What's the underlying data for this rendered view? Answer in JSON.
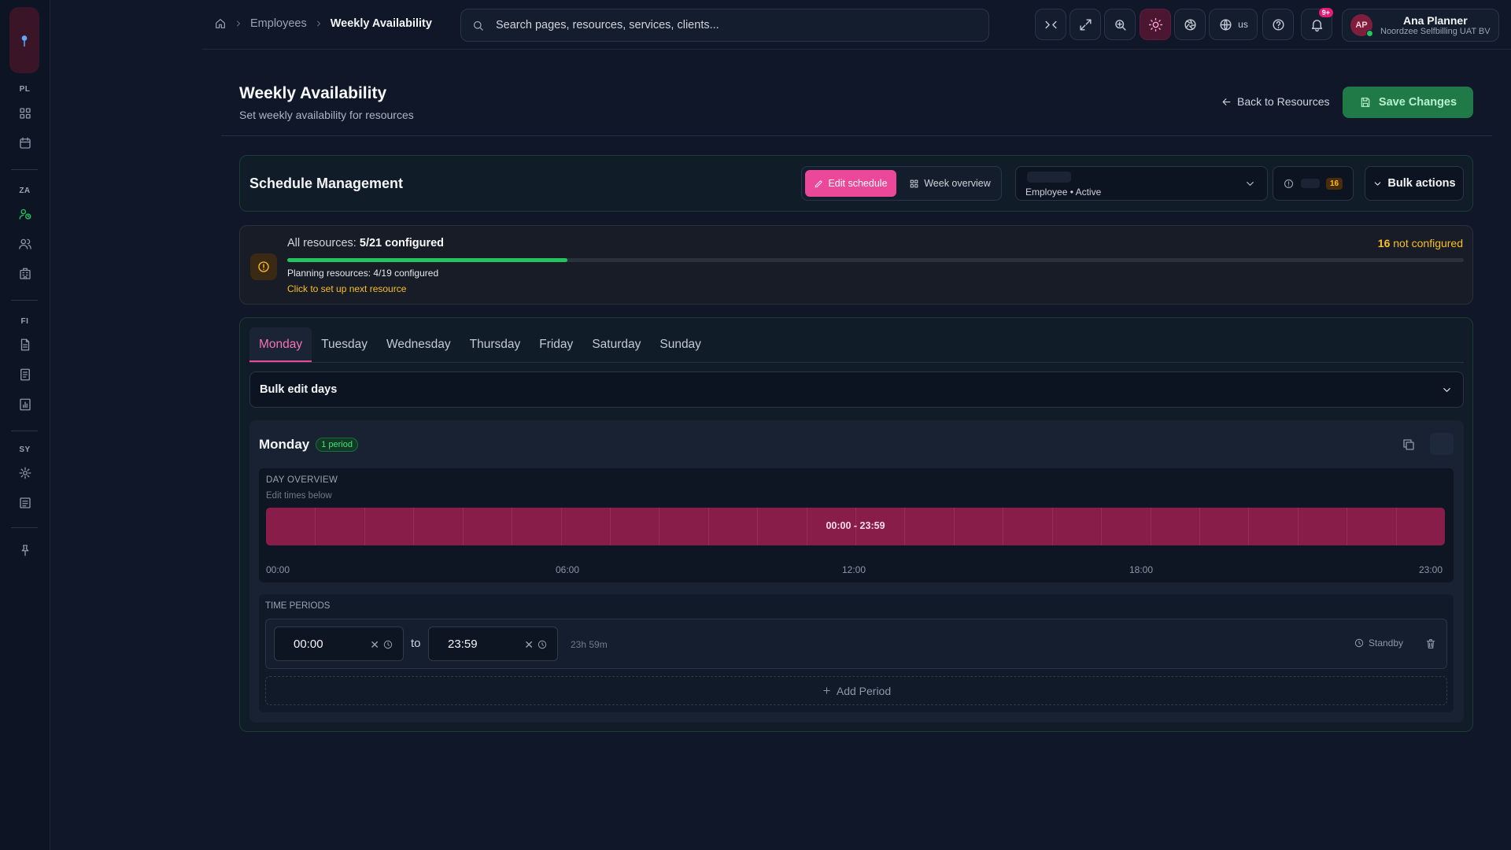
{
  "sidebar": {
    "sections": [
      {
        "label": "PL",
        "items": [
          {
            "icon": "grid-icon"
          },
          {
            "icon": "calendar-icon"
          }
        ]
      },
      {
        "label": "ZA",
        "items": [
          {
            "icon": "user-clock-icon"
          },
          {
            "icon": "users-icon"
          },
          {
            "icon": "building-icon"
          }
        ]
      },
      {
        "label": "FI",
        "items": [
          {
            "icon": "document-icon"
          },
          {
            "icon": "receipt-icon"
          },
          {
            "icon": "bar-chart-icon"
          }
        ]
      },
      {
        "label": "SY",
        "items": [
          {
            "icon": "gear-icon"
          },
          {
            "icon": "log-icon"
          }
        ]
      }
    ]
  },
  "header": {
    "breadcrumb": [
      "Employees",
      "Weekly Availability"
    ],
    "search_placeholder": "Search pages, resources, services, clients...",
    "language": "us",
    "notification_badge": "9+",
    "user": {
      "initials": "AP",
      "name": "Ana Planner",
      "org": "Noordzee Selfbilling UAT BV"
    }
  },
  "page": {
    "title": "Weekly Availability",
    "subtitle": "Set weekly availability for resources",
    "back_label": "Back to Resources",
    "save_label": "Save Changes"
  },
  "schedule": {
    "title": "Schedule Management",
    "edit_label": "Edit schedule",
    "week_label": "Week overview",
    "resource_meta": "Employee • Active",
    "not_configured_count": "16",
    "bulk_label": "Bulk actions"
  },
  "progress": {
    "all_prefix": "All resources:",
    "all_value": "5/21 configured",
    "fraction": 0.238,
    "not_count": "16",
    "not_label": "not configured",
    "planning": "Planning resources: 4/19 configured",
    "link": "Click to set up next resource"
  },
  "days": {
    "tabs": [
      "Monday",
      "Tuesday",
      "Wednesday",
      "Thursday",
      "Friday",
      "Saturday",
      "Sunday"
    ],
    "active_tab": "Monday",
    "bulk_edit_label": "Bulk edit days",
    "current": {
      "name": "Monday",
      "period_badge": "1 period",
      "overview_heading": "DAY OVERVIEW",
      "overview_sub": "Edit times below",
      "range_label": "00:00 - 23:59",
      "axis": [
        "00:00",
        "06:00",
        "12:00",
        "18:00",
        "23:00"
      ],
      "periods_heading": "TIME PERIODS",
      "periods": [
        {
          "from": "00:00",
          "to": "23:59",
          "duration": "23h 59m",
          "status": "Standby"
        }
      ],
      "to_label": "to",
      "add_label": "Add Period"
    }
  },
  "colors": {
    "accent": "#ec4899",
    "success": "#22c55e",
    "warning": "#fbbf24"
  }
}
